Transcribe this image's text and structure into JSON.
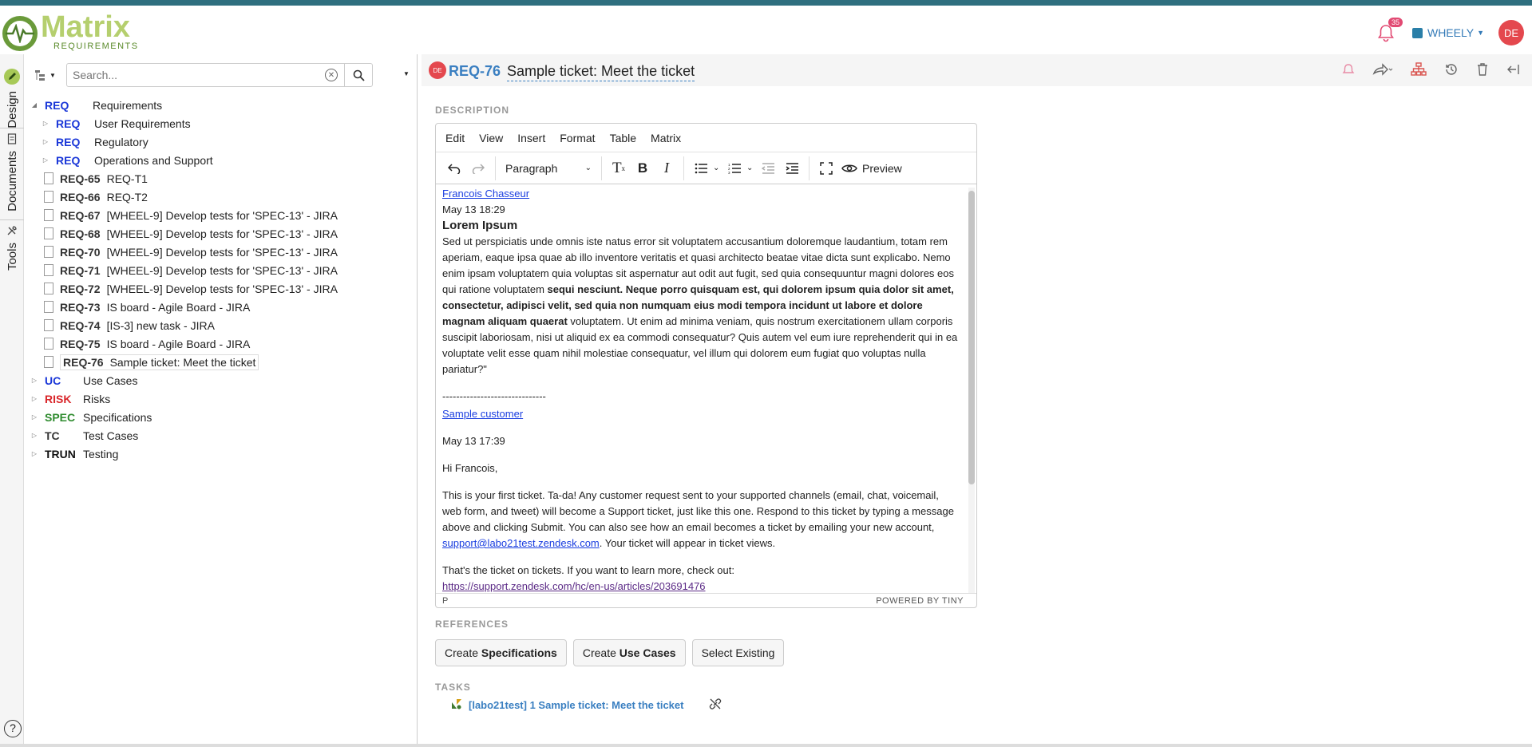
{
  "brand": {
    "title": "Matrix",
    "subtitle": "REQUIREMENTS"
  },
  "header": {
    "notification_count": "35",
    "project": "WHEELY",
    "user_initials": "DE"
  },
  "rail": {
    "tabs": [
      "Design",
      "Documents",
      "Tools"
    ],
    "help": "?"
  },
  "search": {
    "placeholder": "Search..."
  },
  "tree": [
    {
      "level": 0,
      "expand": "open",
      "cat": "REQ",
      "color": "#1a37d8",
      "label": "Requirements"
    },
    {
      "level": 1,
      "expand": "closed",
      "cat": "REQ",
      "color": "#1a37d8",
      "label": "User Requirements"
    },
    {
      "level": 1,
      "expand": "closed",
      "cat": "REQ",
      "color": "#1a37d8",
      "label": "Regulatory"
    },
    {
      "level": 1,
      "expand": "closed",
      "cat": "REQ",
      "color": "#1a37d8",
      "label": "Operations and Support"
    },
    {
      "level": 1,
      "item": "REQ-65",
      "label": "REQ-T1"
    },
    {
      "level": 1,
      "item": "REQ-66",
      "label": "REQ-T2"
    },
    {
      "level": 1,
      "item": "REQ-67",
      "label": "[WHEEL-9] Develop tests for 'SPEC-13' - JIRA"
    },
    {
      "level": 1,
      "item": "REQ-68",
      "label": "[WHEEL-9] Develop tests for 'SPEC-13' - JIRA"
    },
    {
      "level": 1,
      "item": "REQ-70",
      "label": "[WHEEL-9] Develop tests for 'SPEC-13' - JIRA"
    },
    {
      "level": 1,
      "item": "REQ-71",
      "label": "[WHEEL-9] Develop tests for 'SPEC-13' - JIRA"
    },
    {
      "level": 1,
      "item": "REQ-72",
      "label": "[WHEEL-9] Develop tests for 'SPEC-13' - JIRA"
    },
    {
      "level": 1,
      "item": "REQ-73",
      "label": "IS board - Agile Board - JIRA"
    },
    {
      "level": 1,
      "item": "REQ-74",
      "label": "[IS-3] new task - JIRA"
    },
    {
      "level": 1,
      "item": "REQ-75",
      "label": "IS board - Agile Board - JIRA"
    },
    {
      "level": 1,
      "item": "REQ-76",
      "label": "Sample ticket: Meet the ticket",
      "selected": true
    },
    {
      "level": 0,
      "expand": "closed",
      "cat": "UC",
      "color": "#1a37d8",
      "label": "Use Cases"
    },
    {
      "level": 0,
      "expand": "closed",
      "cat": "RISK",
      "color": "#d9262a",
      "label": "Risks"
    },
    {
      "level": 0,
      "expand": "closed",
      "cat": "SPEC",
      "color": "#2e8b2e",
      "label": "Specifications"
    },
    {
      "level": 0,
      "expand": "closed",
      "cat": "TC",
      "color": "#333333",
      "label": "Test Cases"
    },
    {
      "level": 0,
      "expand": "closed",
      "cat": "TRUN",
      "color": "#111111",
      "label": "Testing"
    }
  ],
  "item": {
    "avatar": "DE",
    "id": "REQ-76",
    "title": "Sample ticket: Meet the ticket"
  },
  "sections": {
    "description": "DESCRIPTION",
    "references": "REFERENCES",
    "tasks": "TASKS"
  },
  "editor": {
    "menus": [
      "Edit",
      "View",
      "Insert",
      "Format",
      "Table",
      "Matrix"
    ],
    "block_format": "Paragraph",
    "preview": "Preview",
    "status_path": "P",
    "powered": "POWERED BY TINY",
    "author": "Francois Chasseur",
    "date1": "May 13 18:29",
    "heading": "Lorem Ipsum",
    "p1_a": "Sed ut perspiciatis unde omnis iste natus error sit voluptatem accusantium doloremque laudantium, totam rem aperiam, eaque ipsa quae ab illo inventore veritatis et quasi architecto beatae vitae dicta sunt explicabo. Nemo enim ipsam voluptatem quia voluptas sit aspernatur aut odit aut fugit, sed quia consequuntur magni dolores eos qui ratione voluptatem ",
    "p1_bold": "sequi nesciunt. Neque porro quisquam est, qui dolorem ipsum quia dolor sit amet, consectetur, adipisci velit, sed quia non numquam eius modi tempora incidunt ut labore et dolore magnam aliquam quaerat",
    "p1_b": " voluptatem. Ut enim ad minima veniam, quis nostrum exercitationem ullam corporis suscipit laboriosam, nisi ut aliquid ex ea commodi consequatur? Quis autem vel eum iure reprehenderit qui in ea voluptate velit esse quam nihil molestiae consequatur, vel illum qui dolorem eum fugiat quo voluptas nulla pariatur?\"",
    "divider": "------------------------------",
    "customer": "Sample customer",
    "date2": "May 13 17:39",
    "greeting": "Hi Francois,",
    "p2": "This is your first ticket. Ta-da! Any customer request sent to your supported channels (email, chat, voicemail, web form, and tweet) will become a Support ticket, just like this one. Respond to this ticket by typing a message above and clicking Submit. You can also see how an email becomes a ticket by emailing your new account, ",
    "email": "support@labo21test.zendesk.com",
    "p2_end": ". Your ticket will appear in ticket views.",
    "p3": "That's the ticket on tickets. If you want to learn more, check out:",
    "link": "https://support.zendesk.com/hc/en-us/articles/203691476"
  },
  "references": {
    "create_spec_prefix": "Create ",
    "create_spec_bold": "Specifications",
    "create_uc_prefix": "Create ",
    "create_uc_bold": "Use Cases",
    "select_existing": "Select Existing"
  },
  "task": {
    "label": "[labo21test] 1 Sample ticket: Meet the ticket"
  }
}
